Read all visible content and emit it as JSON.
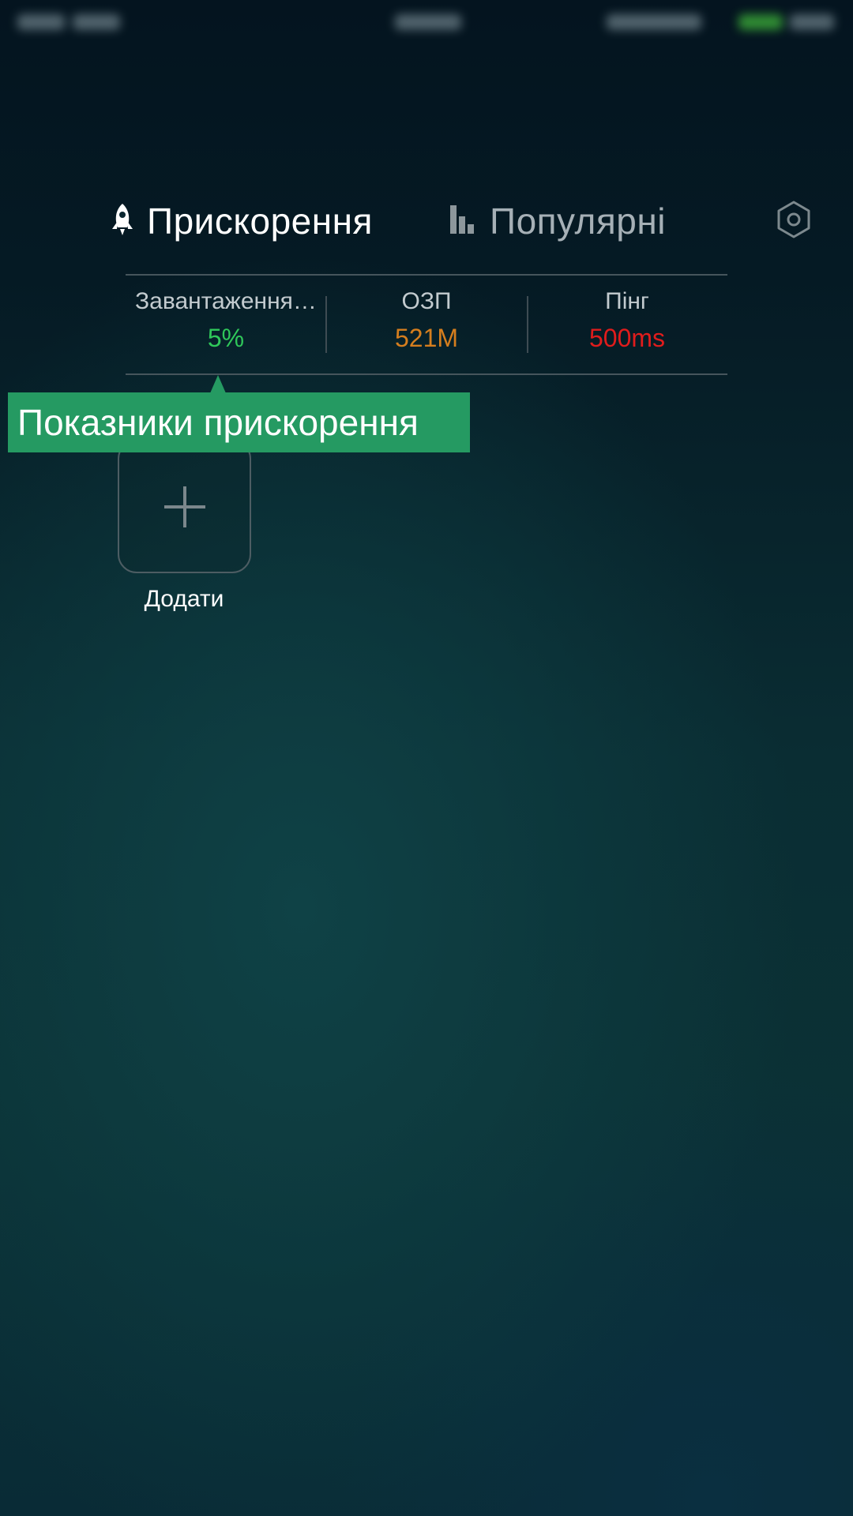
{
  "colors": {
    "cpu_value": "#2fc85a",
    "ram_value": "#d57e1e",
    "ping_value": "#e01c1c",
    "tooltip_bg": "#259a62"
  },
  "tabs": [
    {
      "label": "Прискорення",
      "icon": "rocket-icon",
      "active": true
    },
    {
      "label": "Популярні",
      "icon": "bar-chart-icon",
      "active": false
    }
  ],
  "settings": {
    "icon": "gear-icon"
  },
  "stats": [
    {
      "label": "Завантаження…",
      "value": "5%"
    },
    {
      "label": "ОЗП",
      "value": "521M"
    },
    {
      "label": "Пінг",
      "value": "500ms"
    }
  ],
  "tooltip": {
    "text": "Показники прискорення"
  },
  "add": {
    "label": "Додати",
    "icon": "plus-icon"
  }
}
